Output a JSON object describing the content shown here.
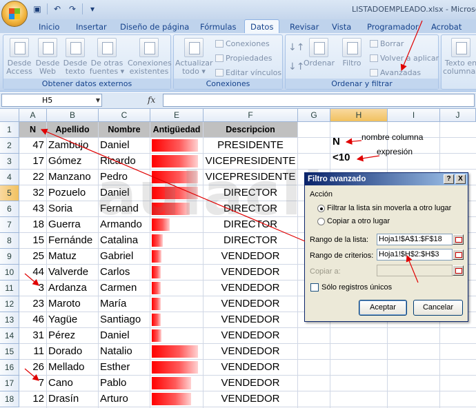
{
  "window": {
    "title": "LISTADOEMPLEADO.xlsx - Microsoft"
  },
  "qat": {
    "save_icon": "save-icon",
    "undo_icon": "undo-icon",
    "redo_icon": "redo-icon"
  },
  "tabs": [
    "Inicio",
    "Insertar",
    "Diseño de página",
    "Fórmulas",
    "Datos",
    "Revisar",
    "Vista",
    "Programador",
    "Acrobat"
  ],
  "ribbon": {
    "groups": {
      "external": "Obtener datos externos",
      "connections": "Conexiones",
      "sort_filter": "Ordenar y filtrar"
    },
    "buttons": {
      "from_access": "Desde\nAccess",
      "from_web": "Desde\nWeb",
      "from_text": "Desde\ntexto",
      "other_sources": "De otras\nfuentes ▾",
      "existing": "Conexiones\nexistentes",
      "refresh": "Actualizar\ntodo ▾",
      "conn": "Conexiones",
      "props": "Propiedades",
      "edit_links": "Editar vínculos",
      "sort": "Ordenar",
      "filter": "Filtro",
      "clear": "Borrar",
      "reapply": "Volver a aplicar",
      "advanced": "Avanzadas",
      "text_cols": "Texto en\ncolumnas"
    }
  },
  "formula_bar": {
    "name_box": "H5",
    "fx": "fx",
    "value": ""
  },
  "columns": [
    "A",
    "B",
    "C",
    "E",
    "F",
    "G",
    "H",
    "I",
    "J"
  ],
  "rows": [
    "1",
    "2",
    "3",
    "4",
    "5",
    "6",
    "7",
    "8",
    "9",
    "10",
    "11",
    "12",
    "13",
    "14",
    "15",
    "16",
    "17",
    "18"
  ],
  "headers": {
    "n": "N",
    "apellido": "Apellido",
    "nombre": "Nombre",
    "antig": "Antigüedad",
    "desc": "Descripcion"
  },
  "table": [
    {
      "n": "47",
      "apellido": "Zambujo",
      "nombre": "Daniel",
      "antig": 0.95,
      "desc": "PRESIDENTE"
    },
    {
      "n": "17",
      "apellido": "Gómez",
      "nombre": "Ricardo",
      "antig": 0.95,
      "desc": "VICEPRESIDENTE"
    },
    {
      "n": "22",
      "apellido": "Manzano",
      "nombre": "Pedro",
      "antig": 0.95,
      "desc": "VICEPRESIDENTE"
    },
    {
      "n": "32",
      "apellido": "Pozuelo",
      "nombre": "Daniel",
      "antig": 0.95,
      "desc": "DIRECTOR"
    },
    {
      "n": "43",
      "apellido": "Soria",
      "nombre": "Fernand",
      "antig": 0.78,
      "desc": "DIRECTOR"
    },
    {
      "n": "18",
      "apellido": "Guerra",
      "nombre": "Armando",
      "antig": 0.37,
      "desc": "DIRECTOR"
    },
    {
      "n": "15",
      "apellido": "Fernánde",
      "nombre": "Catalina",
      "antig": 0.22,
      "desc": "DIRECTOR"
    },
    {
      "n": "25",
      "apellido": "Matuz",
      "nombre": "Gabriel",
      "antig": 0.2,
      "desc": "VENDEDOR"
    },
    {
      "n": "44",
      "apellido": "Valverde",
      "nombre": "Carlos",
      "antig": 0.18,
      "desc": "VENDEDOR"
    },
    {
      "n": "3",
      "apellido": "Ardanza",
      "nombre": "Carmen",
      "antig": 0.18,
      "desc": "VENDEDOR"
    },
    {
      "n": "23",
      "apellido": "Maroto",
      "nombre": "María",
      "antig": 0.18,
      "desc": "VENDEDOR"
    },
    {
      "n": "46",
      "apellido": "Yagüe",
      "nombre": "Santiago",
      "antig": 0.18,
      "desc": "VENDEDOR"
    },
    {
      "n": "31",
      "apellido": "Pérez",
      "nombre": "Daniel",
      "antig": 0.2,
      "desc": "VENDEDOR"
    },
    {
      "n": "11",
      "apellido": "Dorado",
      "nombre": "Natalio",
      "antig": 0.95,
      "desc": "VENDEDOR"
    },
    {
      "n": "26",
      "apellido": "Mellado",
      "nombre": "Esther",
      "antig": 0.95,
      "desc": "VENDEDOR"
    },
    {
      "n": "7",
      "apellido": "Cano",
      "nombre": "Pablo",
      "antig": 0.8,
      "desc": "VENDEDOR"
    },
    {
      "n": "12",
      "apellido": "Drasín",
      "nombre": "Arturo",
      "antig": 0.8,
      "desc": "VENDEDOR"
    }
  ],
  "criteria": {
    "h2": "N",
    "h3": "<10"
  },
  "notes": {
    "column_name": "nombre columna",
    "expression": "expresión"
  },
  "watermark": "aulaclic.es",
  "dialog": {
    "title": "Filtro avanzado",
    "help": "?",
    "close": "X",
    "action_label": "Acción",
    "radio_filter": "Filtrar la lista sin moverla a otro lugar",
    "radio_copy": "Copiar a otro lugar",
    "list_range_label": "Rango de la lista:",
    "list_range_value": "Hoja1!$A$1:$F$18",
    "criteria_range_label": "Rango de criterios:",
    "criteria_range_value": "Hoja1!$H$2:$H$3",
    "copy_to_label": "Copiar a:",
    "unique_label": "Sólo registros únicos",
    "ok": "Aceptar",
    "cancel": "Cancelar"
  },
  "colors": {
    "accent": "#15428b",
    "bar": "#ff0000",
    "annotation": "#e00000",
    "selected": "#f1c15f"
  }
}
